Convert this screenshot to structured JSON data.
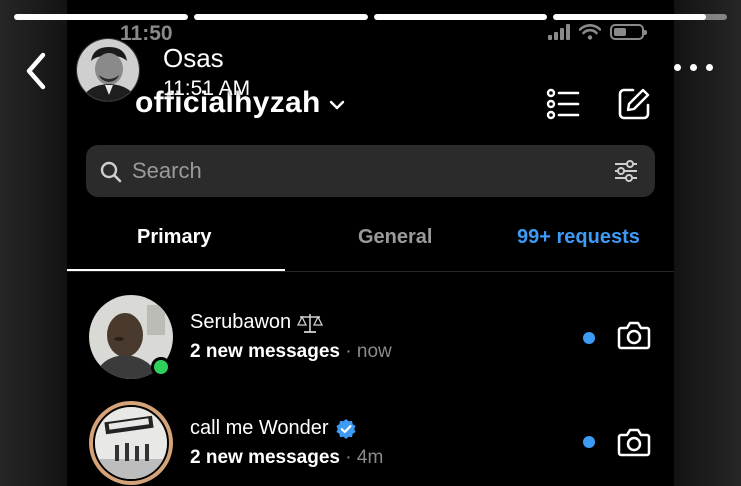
{
  "story": {
    "progress": [
      1,
      1,
      1,
      0.88
    ],
    "username": "Osas",
    "time": "11:51 AM",
    "avatar_icon": "profile-photo-icon",
    "back_icon": "chevron-left-icon",
    "more_icon": "more-horizontal-icon"
  },
  "screenshot": {
    "status": {
      "time": "11:50",
      "battery_level": 0.45
    },
    "header": {
      "account_name": "officialhyzah",
      "list_icon": "list-icon",
      "compose_icon": "new-message-icon"
    },
    "search": {
      "placeholder": "Search",
      "icon": "search-icon",
      "filter_icon": "filter-icon"
    },
    "tabs": [
      {
        "label": "Primary",
        "selected": true
      },
      {
        "label": "General",
        "selected": false
      },
      {
        "label": "99+ requests",
        "color": "#3d9af5"
      }
    ],
    "conversations": [
      {
        "name": "Serubawon",
        "badge_icon": "scales-icon",
        "preview": "2 new messages",
        "time": "· now",
        "online": true,
        "unread": true
      },
      {
        "name": "call me Wonder",
        "badge_icon": "verified-badge-icon",
        "preview": "2 new messages",
        "time": "· 4m",
        "online": false,
        "unread": true
      }
    ]
  },
  "colors": {
    "accent_blue": "#3d9af5",
    "online_green": "#2fd15d",
    "story_ring": "#d4a37a"
  }
}
